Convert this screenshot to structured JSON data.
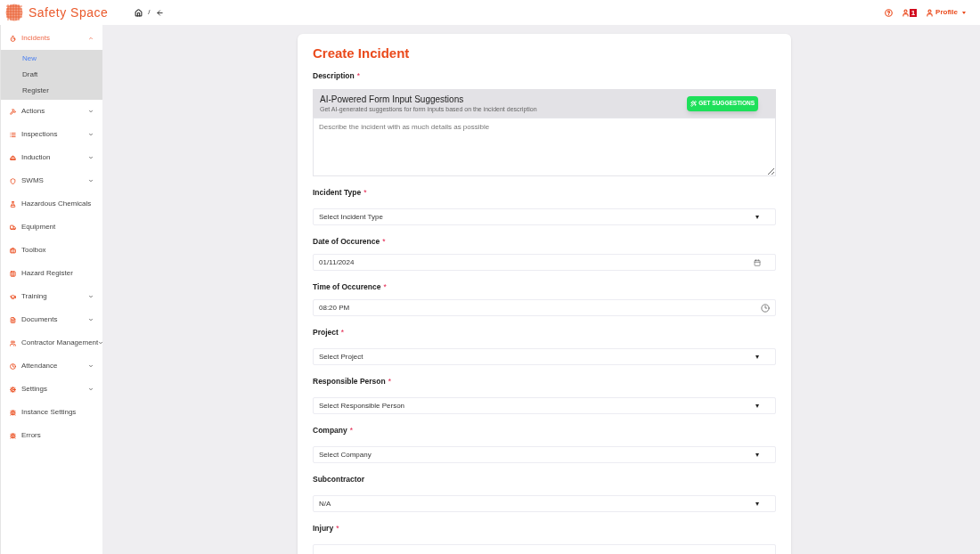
{
  "header": {
    "brand": "Safety Space",
    "breadcrumb_separator": "/",
    "notification_count": "1",
    "profile": "Profile"
  },
  "sidebar": {
    "items": [
      {
        "label": "Incidents",
        "selected": true,
        "expanded": true,
        "children": [
          {
            "label": "New",
            "selected": true
          },
          {
            "label": "Draft",
            "selected": false
          },
          {
            "label": "Register",
            "selected": false
          }
        ]
      },
      {
        "label": "Actions",
        "selected": false,
        "expanded": false
      },
      {
        "label": "Inspections",
        "selected": false,
        "expanded": false
      },
      {
        "label": "Induction",
        "selected": false,
        "expanded": false
      },
      {
        "label": "SWMS",
        "selected": false,
        "expanded": false
      },
      {
        "label": "Hazardous Chemicals",
        "selected": false
      },
      {
        "label": "Equipment",
        "selected": false
      },
      {
        "label": "Toolbox",
        "selected": false
      },
      {
        "label": "Hazard Register",
        "selected": false
      },
      {
        "label": "Training",
        "selected": false,
        "expanded": false
      },
      {
        "label": "Documents",
        "selected": false,
        "expanded": false
      },
      {
        "label": "Contractor Management",
        "selected": false,
        "expanded": false
      },
      {
        "label": "Attendance",
        "selected": false,
        "expanded": false
      },
      {
        "label": "Settings",
        "selected": false,
        "expanded": false
      },
      {
        "label": "Instance Settings",
        "selected": false
      },
      {
        "label": "Errors",
        "selected": false
      }
    ]
  },
  "form": {
    "title": "Create Incident",
    "fields": [
      {
        "kind": "description",
        "label": "Description",
        "required_mark": "*",
        "ai_title": "AI-Powered Form Input Suggestions",
        "ai_subtitle": "Get AI-generated suggestions for form inputs based on the incident description",
        "ai_button": "GET SUGGESTIONS",
        "placeholder": "Describe the incident with as much details as possible"
      },
      {
        "kind": "select",
        "label": "Incident Type",
        "required_mark": "*",
        "value": "Select Incident Type"
      },
      {
        "kind": "date",
        "label": "Date of Occurence",
        "required_mark": "*",
        "value": "01/11/2024"
      },
      {
        "kind": "time",
        "label": "Time of Occurence",
        "required_mark": "*",
        "value": "08:20 PM"
      },
      {
        "kind": "select",
        "label": "Project",
        "required_mark": "*",
        "value": "Select Project"
      },
      {
        "kind": "select",
        "label": "Responsible Person",
        "required_mark": "*",
        "value": "Select Responsible Person"
      },
      {
        "kind": "select",
        "label": "Company",
        "required_mark": "*",
        "value": "Select Company"
      },
      {
        "kind": "select",
        "label": "Subcontractor",
        "value": "N/A"
      },
      {
        "kind": "select",
        "label": "Injury",
        "required_mark": "*"
      }
    ]
  }
}
